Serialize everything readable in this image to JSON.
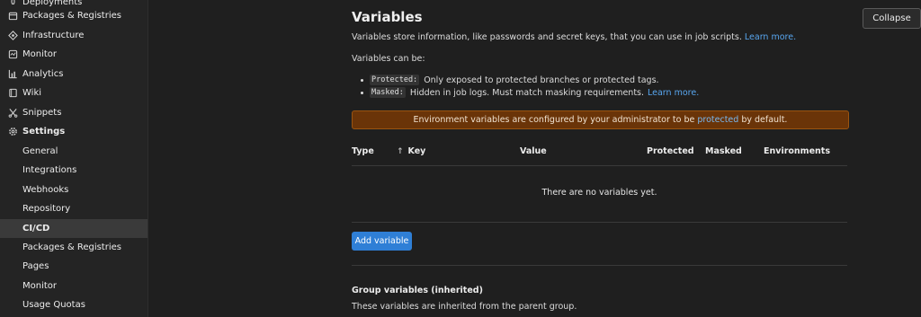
{
  "sidebar": {
    "items": [
      {
        "label": "Deployments",
        "icon": "rocket-icon",
        "kind": "top"
      },
      {
        "label": "Packages & Registries",
        "icon": "package-icon",
        "kind": "top"
      },
      {
        "label": "Infrastructure",
        "icon": "infrastructure-icon",
        "kind": "top"
      },
      {
        "label": "Monitor",
        "icon": "monitor-icon",
        "kind": "top"
      },
      {
        "label": "Analytics",
        "icon": "chart-icon",
        "kind": "top"
      },
      {
        "label": "Wiki",
        "icon": "book-icon",
        "kind": "top"
      },
      {
        "label": "Snippets",
        "icon": "scissors-icon",
        "kind": "top"
      },
      {
        "label": "Settings",
        "icon": "gear-icon",
        "kind": "top-bold"
      },
      {
        "label": "General",
        "kind": "sub"
      },
      {
        "label": "Integrations",
        "kind": "sub"
      },
      {
        "label": "Webhooks",
        "kind": "sub"
      },
      {
        "label": "Repository",
        "kind": "sub"
      },
      {
        "label": "CI/CD",
        "kind": "sub-active"
      },
      {
        "label": "Packages & Registries",
        "kind": "sub"
      },
      {
        "label": "Pages",
        "kind": "sub"
      },
      {
        "label": "Monitor",
        "kind": "sub"
      },
      {
        "label": "Usage Quotas",
        "kind": "sub"
      }
    ]
  },
  "variables": {
    "title": "Variables",
    "collapse_label": "Collapse",
    "description": "Variables store information, like passwords and secret keys, that you can use in job scripts.",
    "learn_more": "Learn more.",
    "can_be": "Variables can be:",
    "bullets": [
      {
        "code": "Protected:",
        "text": "Only exposed to protected branches or protected tags."
      },
      {
        "code": "Masked:",
        "text": "Hidden in job logs. Must match masking requirements.",
        "link": "Learn more."
      }
    ],
    "alert": {
      "before": "Environment variables are configured by your administrator to be",
      "link": "protected",
      "after": "by default.",
      "color": "#6a3408"
    },
    "table": {
      "headers": {
        "type": "Type",
        "key": "Key",
        "value": "Value",
        "protected": "Protected",
        "masked": "Masked",
        "environments": "Environments"
      },
      "empty_text": "There are no variables yet."
    },
    "add_button": "Add variable",
    "accent_color": "#2f7fd6"
  },
  "group_variables": {
    "title": "Group variables (inherited)",
    "description": "These variables are inherited from the parent group."
  }
}
